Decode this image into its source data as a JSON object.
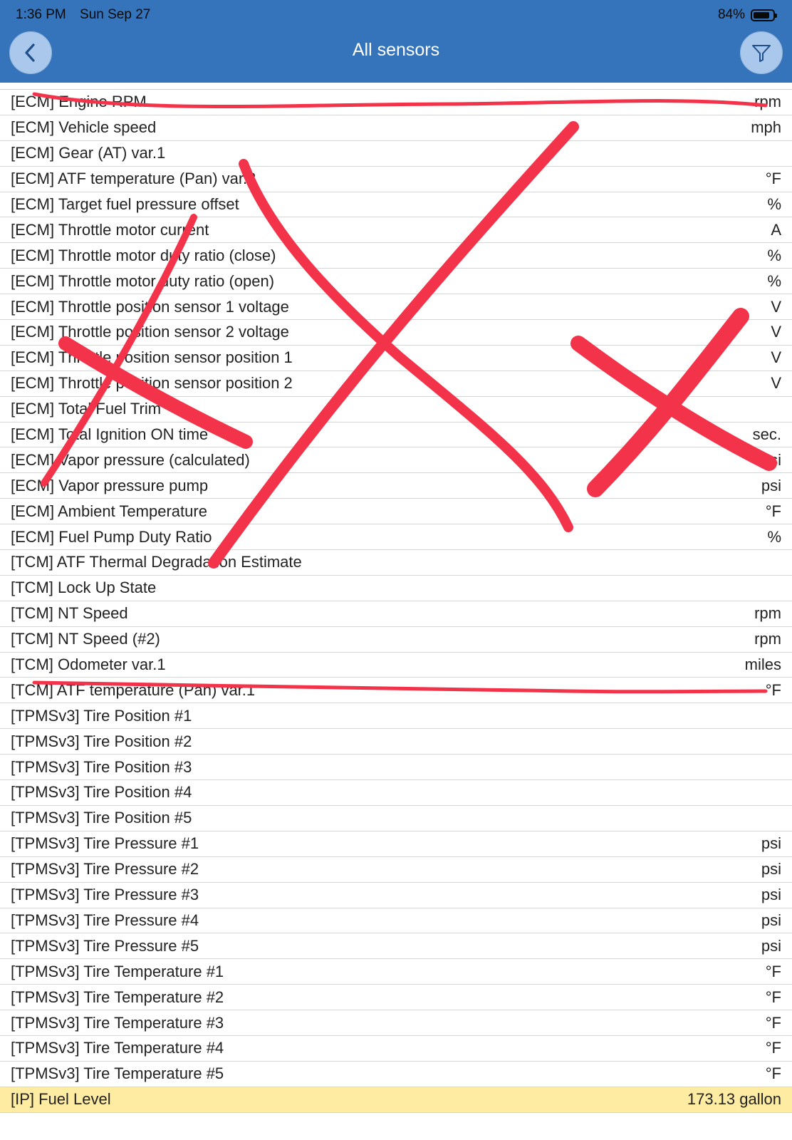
{
  "status_bar": {
    "time": "1:36 PM",
    "date": "Sun Sep 27",
    "battery": "84%",
    "battery_level": 0.84
  },
  "header": {
    "title": "All sensors",
    "back_icon": "chevron-left-icon",
    "filter_icon": "filter-icon",
    "background": "#3574ba"
  },
  "sensors": [
    {
      "name": "[ECM] Engine RPM",
      "unit": "rpm"
    },
    {
      "name": "[ECM] Vehicle speed",
      "unit": "mph"
    },
    {
      "name": "[ECM] Gear (AT) var.1",
      "unit": ""
    },
    {
      "name": "[ECM] ATF temperature (Pan) var.3",
      "unit": "°F"
    },
    {
      "name": "[ECM] Target fuel pressure offset",
      "unit": "%"
    },
    {
      "name": "[ECM] Throttle motor current",
      "unit": "A"
    },
    {
      "name": "[ECM] Throttle motor duty ratio (close)",
      "unit": "%"
    },
    {
      "name": "[ECM] Throttle motor duty ratio (open)",
      "unit": "%"
    },
    {
      "name": "[ECM] Throttle position sensor 1 voltage",
      "unit": "V"
    },
    {
      "name": "[ECM] Throttle position sensor 2 voltage",
      "unit": "V"
    },
    {
      "name": "[ECM] Throttle position sensor position 1",
      "unit": "V"
    },
    {
      "name": "[ECM] Throttle position sensor position 2",
      "unit": "V"
    },
    {
      "name": "[ECM] Total Fuel Trim",
      "unit": ""
    },
    {
      "name": "[ECM] Total Ignition ON time",
      "unit": "sec."
    },
    {
      "name": "[ECM] Vapor pressure (calculated)",
      "unit": "psi"
    },
    {
      "name": "[ECM] Vapor pressure pump",
      "unit": "psi"
    },
    {
      "name": "[ECM] Ambient Temperature",
      "unit": "°F"
    },
    {
      "name": "[ECM] Fuel Pump Duty Ratio",
      "unit": "%"
    },
    {
      "name": "[TCM] ATF Thermal Degradation Estimate",
      "unit": ""
    },
    {
      "name": "[TCM] Lock Up State",
      "unit": ""
    },
    {
      "name": "[TCM] NT Speed",
      "unit": "rpm"
    },
    {
      "name": "[TCM] NT Speed (#2)",
      "unit": "rpm"
    },
    {
      "name": "[TCM] Odometer var.1",
      "unit": "miles"
    },
    {
      "name": "[TCM] ATF temperature (Pan) var.1",
      "unit": "°F"
    },
    {
      "name": "[TPMSv3] Tire Position #1",
      "unit": ""
    },
    {
      "name": "[TPMSv3] Tire Position #2",
      "unit": ""
    },
    {
      "name": "[TPMSv3] Tire Position #3",
      "unit": ""
    },
    {
      "name": "[TPMSv3] Tire Position #4",
      "unit": ""
    },
    {
      "name": "[TPMSv3] Tire Position #5",
      "unit": ""
    },
    {
      "name": "[TPMSv3] Tire Pressure #1",
      "unit": "psi"
    },
    {
      "name": "[TPMSv3] Tire Pressure #2",
      "unit": "psi"
    },
    {
      "name": "[TPMSv3] Tire Pressure #3",
      "unit": "psi"
    },
    {
      "name": "[TPMSv3] Tire Pressure #4",
      "unit": "psi"
    },
    {
      "name": "[TPMSv3] Tire Pressure #5",
      "unit": "psi"
    },
    {
      "name": "[TPMSv3] Tire Temperature #1",
      "unit": "°F"
    },
    {
      "name": "[TPMSv3] Tire Temperature #2",
      "unit": "°F"
    },
    {
      "name": "[TPMSv3] Tire Temperature #3",
      "unit": "°F"
    },
    {
      "name": "[TPMSv3] Tire Temperature #4",
      "unit": "°F"
    },
    {
      "name": "[TPMSv3] Tire Temperature #5",
      "unit": "°F"
    },
    {
      "name": "[IP] Fuel Level",
      "unit": "173.13 gallon",
      "highlighted": true
    }
  ],
  "annotations": {
    "ink_color": "#f2334a",
    "highlight_color": "#ffdd57"
  }
}
